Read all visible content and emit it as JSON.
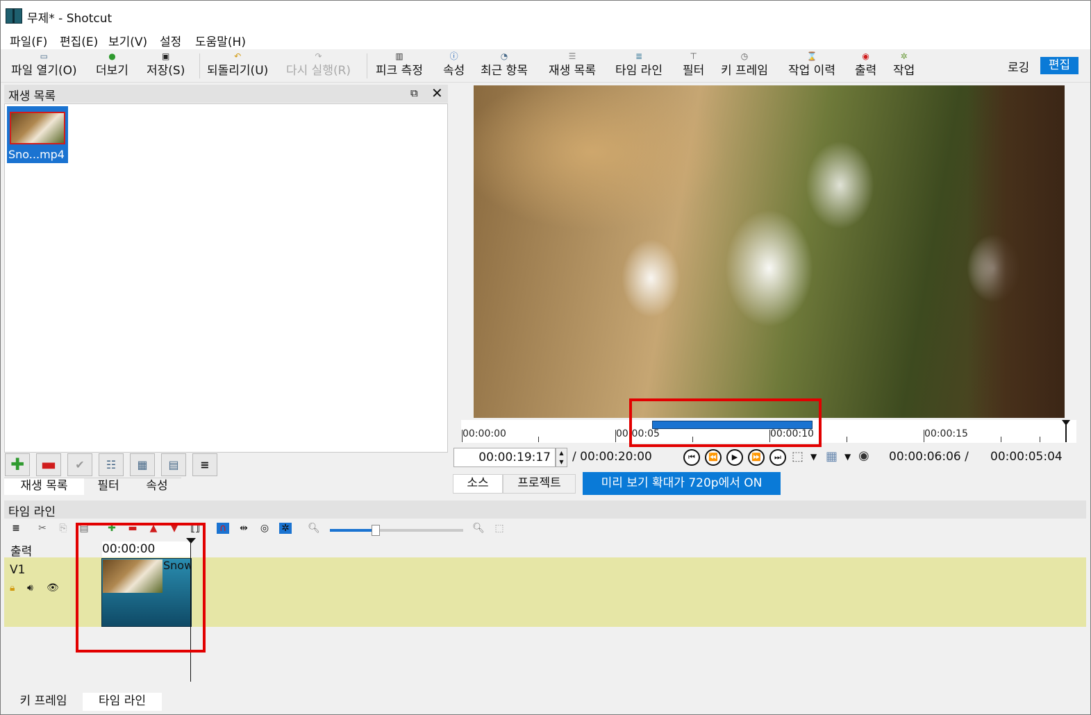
{
  "window": {
    "title": "무제* - Shotcut"
  },
  "menu": [
    "파일(F)",
    "편집(E)",
    "보기(V)",
    "설정",
    "도움말(H)"
  ],
  "toolbar": {
    "items": [
      {
        "label": "파일 열기(O)",
        "icon": "folder-open-icon"
      },
      {
        "label": "더보기",
        "icon": "add-icon"
      },
      {
        "label": "저장(S)",
        "icon": "save-icon"
      },
      {
        "label": "되돌리기(U)",
        "icon": "undo-icon"
      },
      {
        "label": "다시 실행(R)",
        "icon": "redo-icon",
        "disabled": true
      },
      {
        "label": "피크 측정",
        "icon": "meter-icon"
      },
      {
        "label": "속성",
        "icon": "info-icon"
      },
      {
        "label": "최근 항목",
        "icon": "recent-icon"
      },
      {
        "label": "재생 목록",
        "icon": "playlist-icon"
      },
      {
        "label": "타임 라인",
        "icon": "timeline-icon"
      },
      {
        "label": "필터",
        "icon": "filter-icon"
      },
      {
        "label": "키 프레임",
        "icon": "keyframe-icon"
      },
      {
        "label": "작업 이력",
        "icon": "history-icon"
      },
      {
        "label": "출력",
        "icon": "record-icon"
      },
      {
        "label": "작업",
        "icon": "jobs-icon"
      }
    ],
    "layout_logging": "로깅",
    "layout_editing": "편집"
  },
  "playlist": {
    "title": "재생 목록",
    "clip_name": "Sno...mp4",
    "tabs": [
      "재생 목록",
      "필터",
      "속성"
    ]
  },
  "player": {
    "ruler_labels": [
      "00:00:00",
      "00:00:05",
      "00:00:10",
      "00:00:15"
    ],
    "timecode": "00:00:19:17",
    "duration": "/ 00:00:20:00",
    "inout_duration": "00:00:06:06 /",
    "remaining": "00:00:05:04",
    "tabs": [
      "소스",
      "프로젝트"
    ],
    "preview_scale": "미리 보기 확대가 720p에서 ON"
  },
  "timeline": {
    "title": "타임 라인",
    "output_label": "출력",
    "track_label": "V1",
    "timecode": "00:00:00",
    "clip_name": "Snow"
  },
  "bottom_tabs": [
    "키 프레임",
    "타임 라인"
  ],
  "colors": {
    "accent": "#0a7ad7",
    "highlight": "#e20000",
    "track": "#e6e6a6",
    "clip": "#1f6f91"
  }
}
